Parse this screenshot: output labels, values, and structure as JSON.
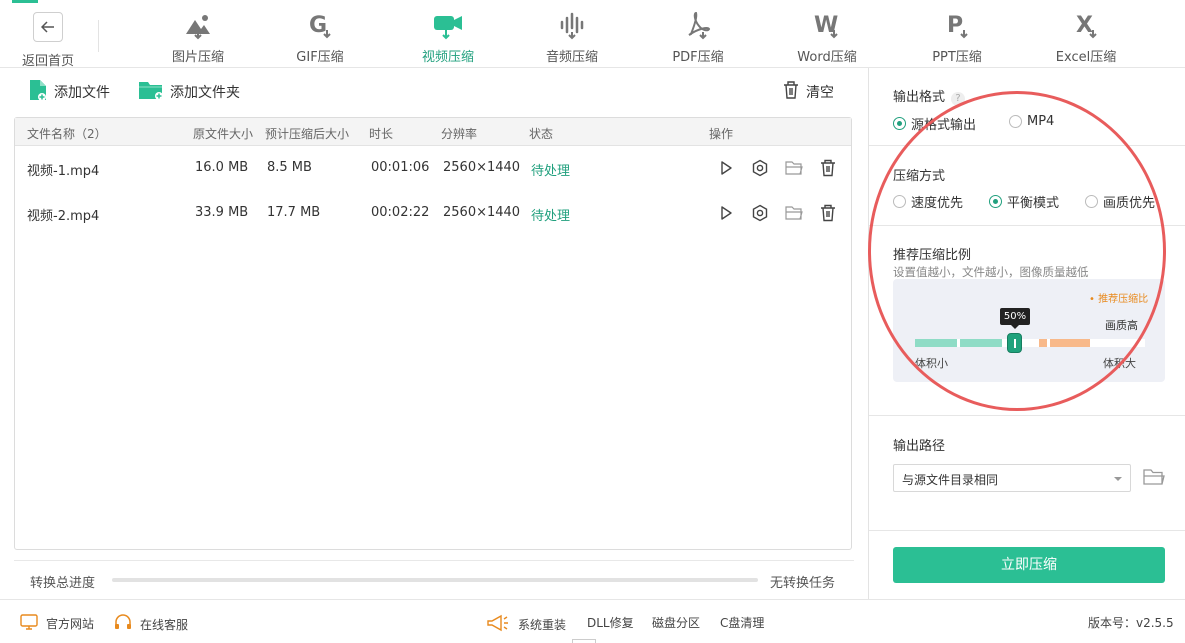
{
  "nav": {
    "back_label": "返回首页",
    "tabs": [
      {
        "label": "图片压缩",
        "icon": "image-compress-icon"
      },
      {
        "label": "GIF压缩",
        "icon": "gif-compress-icon"
      },
      {
        "label": "视频压缩",
        "icon": "video-compress-icon",
        "active": true
      },
      {
        "label": "音频压缩",
        "icon": "audio-compress-icon"
      },
      {
        "label": "PDF压缩",
        "icon": "pdf-compress-icon"
      },
      {
        "label": "Word压缩",
        "icon": "word-compress-icon"
      },
      {
        "label": "PPT压缩",
        "icon": "ppt-compress-icon"
      },
      {
        "label": "Excel压缩",
        "icon": "excel-compress-icon"
      }
    ]
  },
  "toolbar": {
    "add_file": "添加文件",
    "add_folder": "添加文件夹",
    "clear": "清空"
  },
  "table": {
    "headers": {
      "name": "文件名称（2）",
      "orig_size": "原文件大小",
      "est_size": "预计压缩后大小",
      "duration": "时长",
      "resolution": "分辨率",
      "status": "状态",
      "ops": "操作"
    },
    "rows": [
      {
        "name": "视频-1.mp4",
        "orig_size": "16.0 MB",
        "est_size": "8.5 MB",
        "duration": "00:01:06",
        "resolution": "2560×1440",
        "status": "待处理"
      },
      {
        "name": "视频-2.mp4",
        "orig_size": "33.9 MB",
        "est_size": "17.7 MB",
        "duration": "00:02:22",
        "resolution": "2560×1440",
        "status": "待处理"
      }
    ]
  },
  "progress": {
    "label": "转换总进度",
    "value": 0,
    "status": "无转换任务"
  },
  "panel": {
    "output_format": {
      "title": "输出格式",
      "help": "?",
      "options": [
        "源格式输出",
        "MP4"
      ],
      "selected": "源格式输出"
    },
    "compress_mode": {
      "title": "压缩方式",
      "options": [
        "速度优先",
        "平衡模式",
        "画质优先"
      ],
      "selected": "平衡模式"
    },
    "ratio": {
      "title": "推荐压缩比例",
      "hint": "设置值越小，文件越小，图像质量越低",
      "recommend_note": "• 推荐压缩比",
      "quality_label": "画质高",
      "value_percent": 50,
      "value_label": "50%",
      "min_label": "体积小",
      "max_label": "体积大"
    },
    "output_path": {
      "title": "输出路径",
      "value": "与源文件目录相同"
    },
    "compress_button": "立即压缩"
  },
  "footer": {
    "website": "官方网站",
    "support": "在线客服",
    "reinstall": "系统重装",
    "dll": "DLL修复",
    "partition": "磁盘分区",
    "cclean": "C盘清理",
    "version": "版本号：v2.5.5"
  },
  "colors": {
    "accent": "#2bbf94",
    "accent_dark": "#21a07e",
    "highlight_circle": "#e85c5c",
    "recommend": "#e88a1e"
  }
}
